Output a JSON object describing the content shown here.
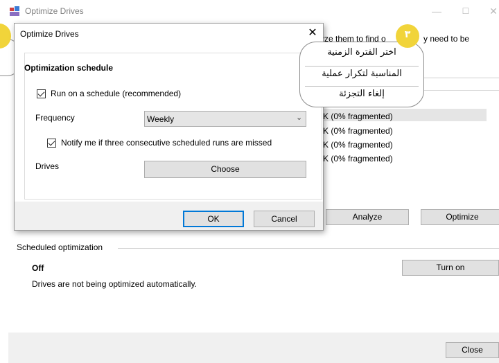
{
  "main": {
    "title": "Optimize Drives",
    "win_min": "—",
    "win_max": "☐",
    "win_close": "✕",
    "desc_fragment": "yze them to find o",
    "desc_fragment_right": "y need to be",
    "drive_rows": [
      "K (0% fragmented)",
      "K (0% fragmented)",
      "K (0% fragmented)",
      "K (0% fragmented)"
    ],
    "analyze_label": "Analyze",
    "optimize_label": "Optimize",
    "scheduled_label": "Scheduled optimization",
    "schedule_state": "Off",
    "schedule_desc": "Drives are not being optimized automatically.",
    "turn_on_label": "Turn on",
    "close_label": "Close"
  },
  "dialog": {
    "title": "Optimize Drives",
    "close_glyph": "✕",
    "group_title": "Optimization schedule",
    "run_schedule_label": "Run on a schedule (recommended)",
    "run_schedule_checked": true,
    "frequency_label": "Frequency",
    "frequency_value": "Weekly",
    "notify_label": "Notify me if three consecutive scheduled runs are missed",
    "notify_checked": true,
    "drives_label": "Drives",
    "choose_label": "Choose",
    "ok_label": "OK",
    "cancel_label": "Cancel"
  },
  "callout": {
    "badge": "٣",
    "lines": [
      "اختر الفترة الزمنية",
      "المناسبة لتكرار عملية",
      "إلغاء التجزئة"
    ]
  },
  "colors": {
    "accent": "#0078d7",
    "badge": "#f1d43a"
  }
}
